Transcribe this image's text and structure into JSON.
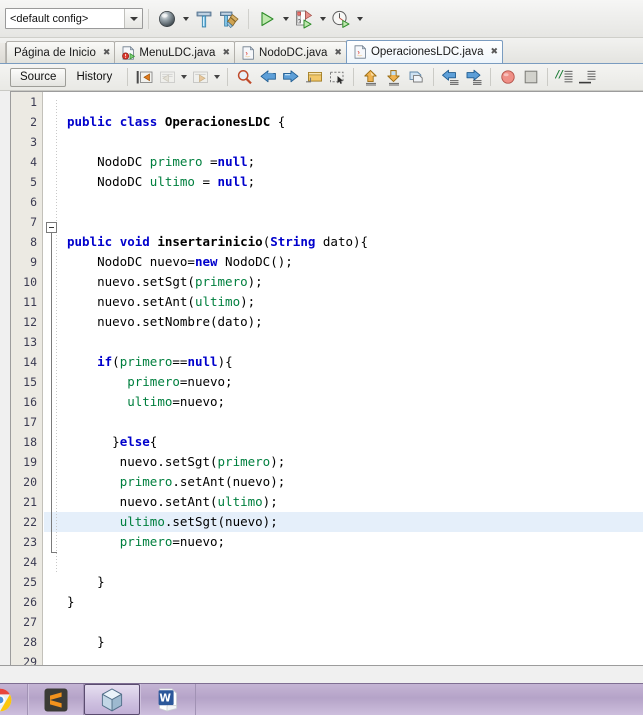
{
  "app": {
    "name": "NetBeans IDE"
  },
  "toolbar": {
    "config_combo": {
      "value": "<default config>",
      "name": "configuration-combobox"
    },
    "buttons": [
      {
        "name": "open-project-icon",
        "label": "Open Project"
      },
      {
        "name": "build-project-icon",
        "label": "Build Project"
      },
      {
        "name": "clean-and-build-icon",
        "label": "Clean and Build Project"
      },
      {
        "name": "run-project-icon",
        "label": "Run Project"
      },
      {
        "name": "debug-project-icon",
        "label": "Debug Project"
      },
      {
        "name": "profile-project-icon",
        "label": "Profile Project"
      }
    ]
  },
  "tabs": [
    {
      "label": "Página de Inicio",
      "icon": "none",
      "active": false,
      "closable": true
    },
    {
      "label": "MenuLDC.java",
      "icon": "java-main-file-icon",
      "active": false,
      "closable": true
    },
    {
      "label": "NodoDC.java",
      "icon": "java-file-icon",
      "active": false,
      "closable": true
    },
    {
      "label": "OperacionesLDC.java",
      "icon": "java-file-icon",
      "active": true,
      "closable": true
    }
  ],
  "editor_toolbar": {
    "source_label": "Source",
    "history_label": "History",
    "buttons": [
      {
        "name": "last-edit-icon"
      },
      {
        "name": "back-icon"
      },
      {
        "name": "forward-icon"
      },
      {
        "name": "find-selection-icon"
      },
      {
        "name": "find-previous-icon"
      },
      {
        "name": "find-next-icon"
      },
      {
        "name": "toggle-highlight-icon"
      },
      {
        "name": "toggle-rectangular-selection-icon"
      },
      {
        "name": "previous-bookmark-icon"
      },
      {
        "name": "next-bookmark-icon"
      },
      {
        "name": "toggle-bookmark-icon"
      },
      {
        "name": "shift-left-icon"
      },
      {
        "name": "shift-right-icon"
      },
      {
        "name": "start-macro-recording-icon"
      },
      {
        "name": "stop-macro-recording-icon"
      },
      {
        "name": "comment-icon"
      },
      {
        "name": "uncomment-icon"
      }
    ]
  },
  "code": {
    "file": "OperacionesLDC.java",
    "highlighted_line": 22,
    "fold_start_line": 8,
    "fold_end_line": 26,
    "line_count": 29,
    "line_numbers": [
      1,
      2,
      3,
      4,
      5,
      6,
      7,
      8,
      9,
      10,
      11,
      12,
      13,
      14,
      15,
      16,
      17,
      18,
      19,
      20,
      21,
      22,
      23,
      24,
      25,
      26,
      27,
      28,
      29
    ],
    "lines": [
      {
        "n": 1,
        "text": ""
      },
      {
        "n": 2,
        "text": "public class OperacionesLDC {"
      },
      {
        "n": 3,
        "text": ""
      },
      {
        "n": 4,
        "text": "    NodoDC primero =null;"
      },
      {
        "n": 5,
        "text": "    NodoDC ultimo = null;"
      },
      {
        "n": 6,
        "text": ""
      },
      {
        "n": 7,
        "text": ""
      },
      {
        "n": 8,
        "text": "public void insertarinicio(String dato){"
      },
      {
        "n": 9,
        "text": "    NodoDC nuevo=new NodoDC();"
      },
      {
        "n": 10,
        "text": "    nuevo.setSgt(primero);"
      },
      {
        "n": 11,
        "text": "    nuevo.setAnt(ultimo);"
      },
      {
        "n": 12,
        "text": "    nuevo.setNombre(dato);"
      },
      {
        "n": 13,
        "text": ""
      },
      {
        "n": 14,
        "text": "    if(primero==null){"
      },
      {
        "n": 15,
        "text": "        primero=nuevo;"
      },
      {
        "n": 16,
        "text": "        ultimo=nuevo;"
      },
      {
        "n": 17,
        "text": ""
      },
      {
        "n": 18,
        "text": "      }else{"
      },
      {
        "n": 19,
        "text": "       nuevo.setSgt(primero);"
      },
      {
        "n": 20,
        "text": "       primero.setAnt(nuevo);"
      },
      {
        "n": 21,
        "text": "       nuevo.setAnt(ultimo);"
      },
      {
        "n": 22,
        "text": "       ultimo.setSgt(nuevo);"
      },
      {
        "n": 23,
        "text": "       primero=nuevo;"
      },
      {
        "n": 24,
        "text": ""
      },
      {
        "n": 25,
        "text": "    }"
      },
      {
        "n": 26,
        "text": "}"
      },
      {
        "n": 27,
        "text": ""
      },
      {
        "n": 28,
        "text": "    }"
      },
      {
        "n": 29,
        "text": ""
      }
    ]
  },
  "taskbar": {
    "items": [
      {
        "name": "taskbar-chrome",
        "label": "Google Chrome",
        "active": false
      },
      {
        "name": "taskbar-sublime-text",
        "label": "Sublime Text",
        "active": false
      },
      {
        "name": "taskbar-netbeans",
        "label": "NetBeans IDE",
        "active": true
      },
      {
        "name": "taskbar-word",
        "label": "Microsoft Word",
        "active": false
      }
    ]
  },
  "colors": {
    "keyword": "#0000cc",
    "field": "#007f3e",
    "plain": "#000000",
    "current_line_highlight": "#e5effa",
    "gutter_bg": "#eceae3",
    "tab_active_border": "#7a9cc0",
    "taskbar_bg": "#b5a3c8"
  }
}
